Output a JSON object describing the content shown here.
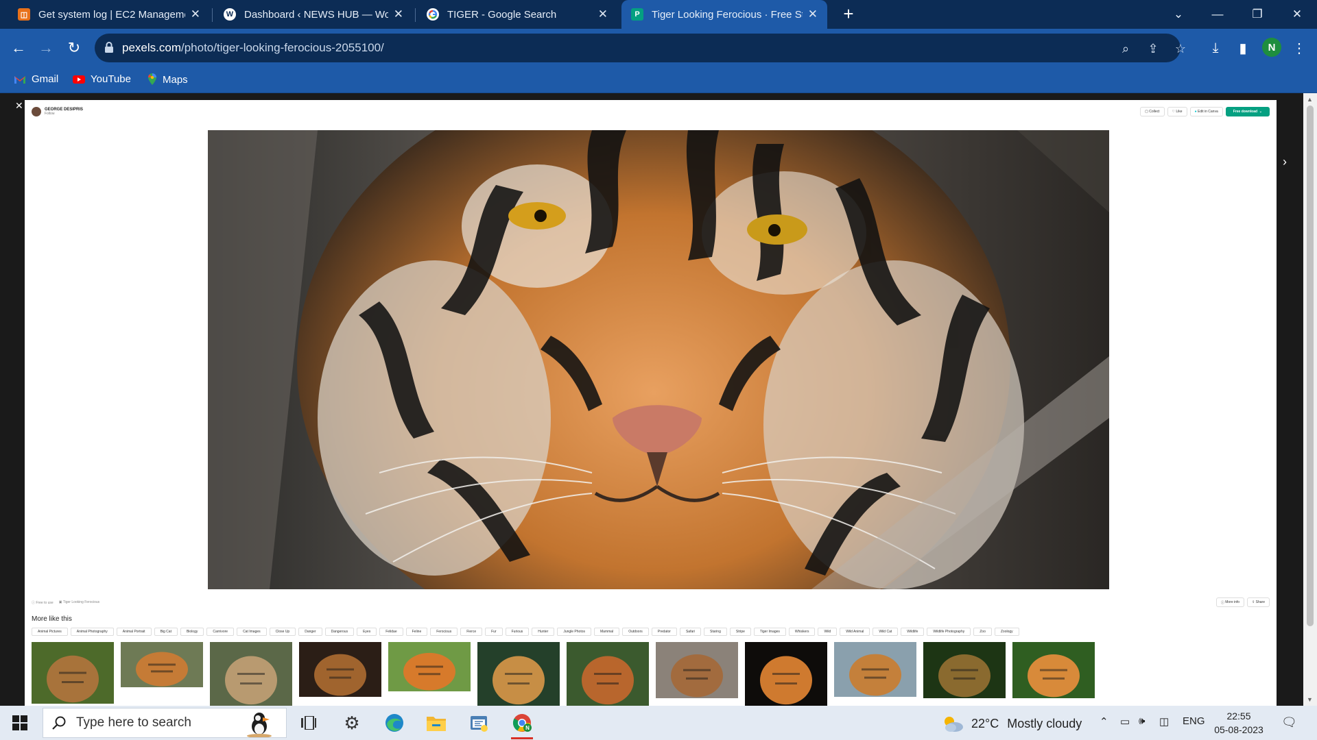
{
  "browser": {
    "tabs": [
      {
        "title": "Get system log | EC2 Manageme",
        "icon": "aws-console-icon",
        "color": "#e8711a"
      },
      {
        "title": "Dashboard ‹ NEWS HUB — Word",
        "icon": "wordpress-icon",
        "color": "#ffffff"
      },
      {
        "title": "TIGER - Google Search",
        "icon": "google-icon",
        "color": "#ffffff"
      },
      {
        "title": "Tiger Looking Ferocious · Free St",
        "icon": "pexels-icon",
        "color": "#05a081"
      }
    ],
    "active_tab": 3,
    "url_host": "pexels.com",
    "url_path": "/photo/tiger-looking-ferocious-2055100/",
    "profile_initial": "N",
    "bookmarks": [
      {
        "label": "Gmail",
        "icon": "gmail-icon"
      },
      {
        "label": "YouTube",
        "icon": "youtube-icon"
      },
      {
        "label": "Maps",
        "icon": "maps-icon"
      }
    ],
    "accent": "#1e5aa8",
    "tabbar_color": "#0c2c55"
  },
  "page": {
    "author_name": "GEORGE DESIPRIS",
    "author_follow": "Follow",
    "actions": {
      "collect": "Collect",
      "like": "Like",
      "edit": "Edit in Canva",
      "download": "Free download"
    },
    "photo_alt": "Tiger Looking Ferocious",
    "meta_left": [
      "Free to use",
      "Tiger Looking Ferocious"
    ],
    "meta_right": [
      "More info",
      "Share"
    ],
    "more_title": "More like this",
    "tags": [
      "Animal Pictures",
      "Animal Photography",
      "Animal Portrait",
      "Big Cat",
      "Biology",
      "Carnivore",
      "Cat Images",
      "Close Up",
      "Danger",
      "Dangerous",
      "Eyes",
      "Felidae",
      "Feline",
      "Ferocious",
      "Fierce",
      "Fur",
      "Furious",
      "Hunter",
      "Jungle Photos",
      "Mammal",
      "Outdoors",
      "Predator",
      "Safari",
      "Staring",
      "Stripe",
      "Tiger Images",
      "Whiskers",
      "Wild",
      "Wild Animal",
      "Wild Cat",
      "Wildlife",
      "Wildlife Photography",
      "Zoo",
      "Zoology"
    ],
    "thumbnails": [
      {
        "subject": "lion",
        "bg": "#4d6a2a",
        "fg": "#a8733b"
      },
      {
        "subject": "two tigers",
        "bg": "#6e7a55",
        "fg": "#c57b36"
      },
      {
        "subject": "lioness",
        "bg": "#5b6848",
        "fg": "#b89a70"
      },
      {
        "subject": "lioness on rock",
        "bg": "#2b1e16",
        "fg": "#a0642e"
      },
      {
        "subject": "tiger lying",
        "bg": "#6f9a45",
        "fg": "#d77a2b"
      },
      {
        "subject": "lion portrait",
        "bg": "#24402a",
        "fg": "#c78e45"
      },
      {
        "subject": "tiger in grass",
        "bg": "#3b5a2e",
        "fg": "#b8662d"
      },
      {
        "subject": "tiger resting",
        "bg": "#8b8279",
        "fg": "#a26b3e"
      },
      {
        "subject": "tiger dark",
        "bg": "#0e0c0a",
        "fg": "#cf7a2f"
      },
      {
        "subject": "tiger on log",
        "bg": "#8aa0ad",
        "fg": "#c4803b"
      },
      {
        "subject": "tiger forest",
        "bg": "#1d3514",
        "fg": "#8a6a2f"
      },
      {
        "subject": "tiger green",
        "bg": "#2f5e21",
        "fg": "#d88a3a"
      }
    ]
  },
  "taskbar": {
    "search_placeholder": "Type here to search",
    "weather_temp": "22°C",
    "weather_desc": "Mostly cloudy",
    "language": "ENG",
    "time": "22:55",
    "date": "05-08-2023"
  }
}
